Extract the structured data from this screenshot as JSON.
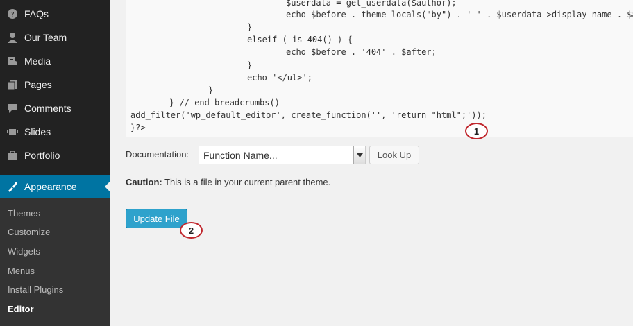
{
  "sidebar": {
    "menu": [
      {
        "label": "FAQs",
        "icon": "faq-icon"
      },
      {
        "label": "Our Team",
        "icon": "team-icon"
      },
      {
        "label": "Media",
        "icon": "media-icon"
      },
      {
        "label": "Pages",
        "icon": "pages-icon"
      },
      {
        "label": "Comments",
        "icon": "comments-icon"
      },
      {
        "label": "Slides",
        "icon": "slides-icon"
      },
      {
        "label": "Portfolio",
        "icon": "portfolio-icon"
      },
      {
        "label": "Appearance",
        "icon": "appearance-icon"
      }
    ],
    "submenu": [
      {
        "label": "Themes"
      },
      {
        "label": "Customize"
      },
      {
        "label": "Widgets"
      },
      {
        "label": "Menus"
      },
      {
        "label": "Install Plugins"
      },
      {
        "label": "Editor"
      }
    ]
  },
  "code": {
    "lines": [
      "$userdata = get_userdata($author);",
      "echo $before . theme_locals(\"by\") . ' ' . $userdata->display_name . $after;",
      "}",
      "elseif ( is_404() ) {",
      "echo $before . '404' . $after;",
      "}",
      "echo '</ul>';",
      "}",
      "} // end breadcrumbs()",
      "add_filter('wp_default_editor', create_function('', 'return \"html\";'));",
      "}?>"
    ]
  },
  "annotations": {
    "marker_1": "1",
    "marker_2": "2"
  },
  "documentation": {
    "label": "Documentation:",
    "select_value": "Function Name...",
    "lookup_label": "Look Up"
  },
  "caution": {
    "label": "Caution:",
    "text": " This is a file in your current parent theme."
  },
  "update_button": "Update File",
  "colors": {
    "sidebar_bg": "#222222",
    "active_bg": "#0074a2",
    "button_primary": "#2ea2cc",
    "marker_border": "#c0272d"
  }
}
